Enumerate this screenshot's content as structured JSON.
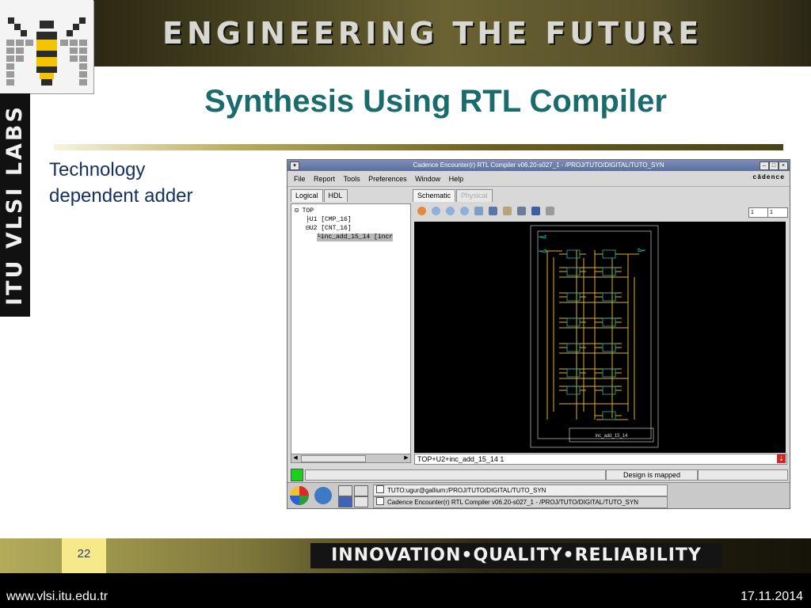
{
  "header": {
    "banner_text": "ENGINEERING THE FUTURE",
    "side_text": "ITU VLSI LABS"
  },
  "slide": {
    "title": "Synthesis Using RTL Compiler",
    "bullet_line1": "Technology",
    "bullet_line2": "dependent adder"
  },
  "app": {
    "window_title": "Cadence Encounter(r) RTL Compiler v06.20-s027_1 - /PROJ/TUTO/DIGITAL/TUTO_SYN",
    "window_buttons": [
      "–",
      "□",
      "×"
    ],
    "menu": [
      "File",
      "Report",
      "Tools",
      "Preferences",
      "Window",
      "Help"
    ],
    "brand": "cādence",
    "left_tabs": [
      "Logical",
      "HDL"
    ],
    "right_tabs": [
      "Schematic",
      "Physical"
    ],
    "tree": [
      "⊟ TOP",
      "├U1 [CMP_16]",
      "⊟U2 [CNT_16]",
      "└inc_add_15_14 [incr"
    ],
    "page_field_1": "1",
    "page_field_2": "1",
    "schematic_module_label": "inc_add_15_14",
    "status_path": "TOP+U2+inc_add_15_14 1",
    "design_status": "Design is mapped",
    "taskbar": [
      "TUTO:ugur@gallium:/PROJ/TUTO/DIGITAL/TUTO_SYN",
      "Cadence Encounter(r) RTL Compiler v06.20-s027_1 - /PROJ/TUTO/DIGITAL/TUTO_SYN"
    ]
  },
  "footer": {
    "slide_number": "22",
    "motto": "INNOVATION•QUALITY•RELIABILITY",
    "url": "www.vlsi.itu.edu.tr",
    "date": "17.11.2014"
  },
  "colors": {
    "title": "#1a6b6b",
    "bullet": "#14305c",
    "schematic_wire": "#e0b12a",
    "schematic_cell": "#1fb3b3"
  }
}
